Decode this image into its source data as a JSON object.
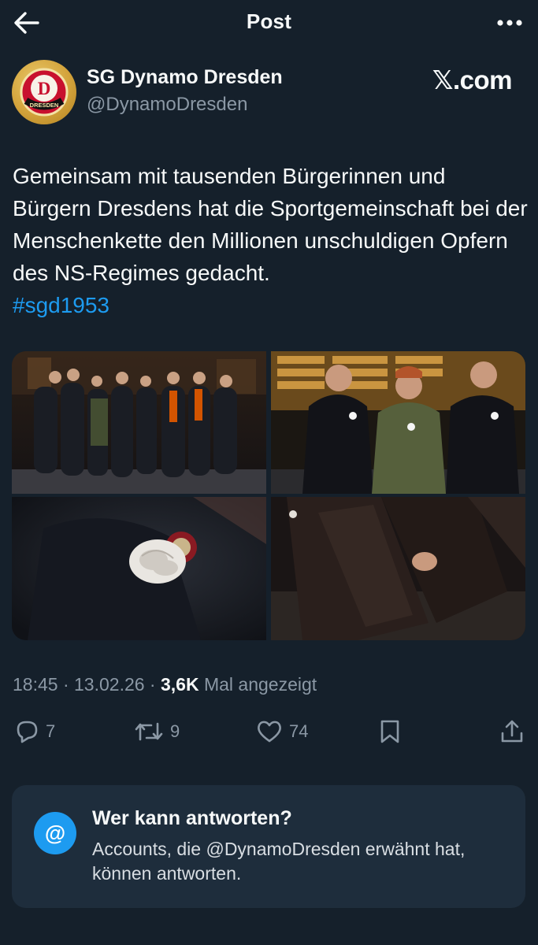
{
  "header": {
    "title": "Post",
    "back_icon": "arrow-left-icon",
    "more_icon": "more-horizontal-icon"
  },
  "author": {
    "name": "SG Dynamo Dresden",
    "handle": "@DynamoDresden",
    "avatar_label": "DRESDEN",
    "avatar_letter": "D"
  },
  "watermark": "𝕏.com",
  "tweet": {
    "text": "Gemeinsam mit tausenden Bürgerinnen und Bürgern Dresdens hat die Sportgemeinschaft bei der Menschenkette den Millionen unschuldigen Opfern des NS-Regimes gedacht.",
    "hashtag": "#sgd1953"
  },
  "media": [
    {
      "description": "group-at-night-photo"
    },
    {
      "description": "three-men-with-white-roses-photo"
    },
    {
      "description": "white-rose-pin-closeup-photo"
    },
    {
      "description": "dark-coats-closeup-photo"
    }
  ],
  "meta": {
    "time": "18:45",
    "sep1": " · ",
    "date": "13.02.26",
    "sep2": " · ",
    "views_count": "3,6K",
    "views_label": " Mal angezeigt"
  },
  "actions": {
    "replies": "7",
    "reposts": "9",
    "likes": "74"
  },
  "reply_restriction": {
    "title": "Wer kann antworten?",
    "description": "Accounts, die @DynamoDresden erwähnt hat, können antworten.",
    "icon_glyph": "@"
  },
  "colors": {
    "background": "#15202b",
    "accent": "#1d9bf0",
    "muted": "#8b98a5",
    "card": "#1e2d3c"
  }
}
